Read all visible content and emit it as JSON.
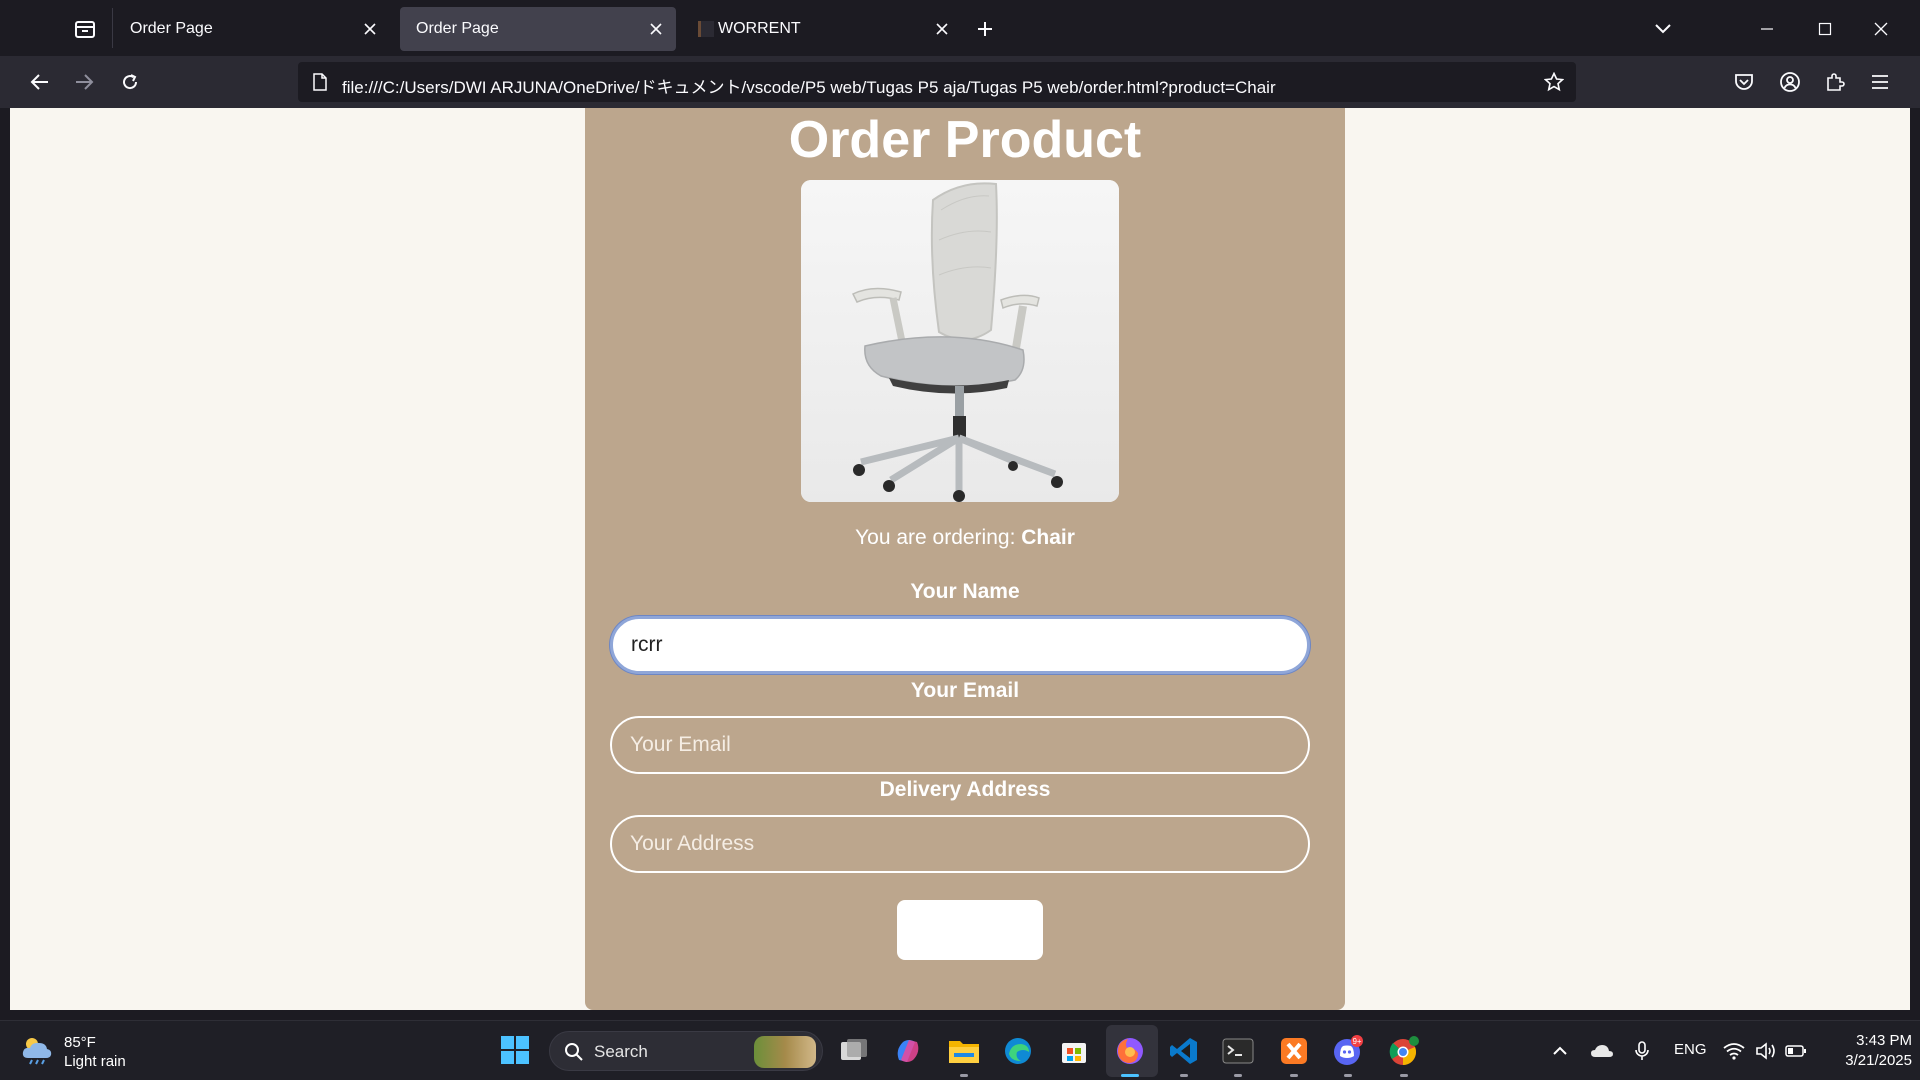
{
  "browser": {
    "tabs": [
      {
        "label": "Order Page",
        "active": false
      },
      {
        "label": "Order Page",
        "active": true
      },
      {
        "label": "WORRENT",
        "active": false
      }
    ],
    "url": "file:///C:/Users/DWI ARJUNA/OneDrive/ドキュメント/vscode/P5 web/Tugas P5 aja/Tugas P5 web/order.html?product=Chair"
  },
  "page": {
    "title": "Order Product",
    "ordering_prefix": "You are ordering: ",
    "product_name": "Chair",
    "form": {
      "name_label": "Your Name",
      "name_value": "rcrr",
      "name_placeholder": "Your Name",
      "email_label": "Your Email",
      "email_placeholder": "Your Email",
      "address_label": "Delivery Address",
      "address_placeholder": "Your Address",
      "submit_label": ""
    },
    "colors": {
      "panel": "#bca68d",
      "background": "#f9f6f0",
      "focus_ring": "#8fa6d8"
    }
  },
  "taskbar": {
    "weather_temp": "85°F",
    "weather_desc": "Light rain",
    "search_label": "Search",
    "language": "ENG",
    "time": "3:43 PM",
    "date": "3/21/2025",
    "discord_badge": "9+"
  }
}
